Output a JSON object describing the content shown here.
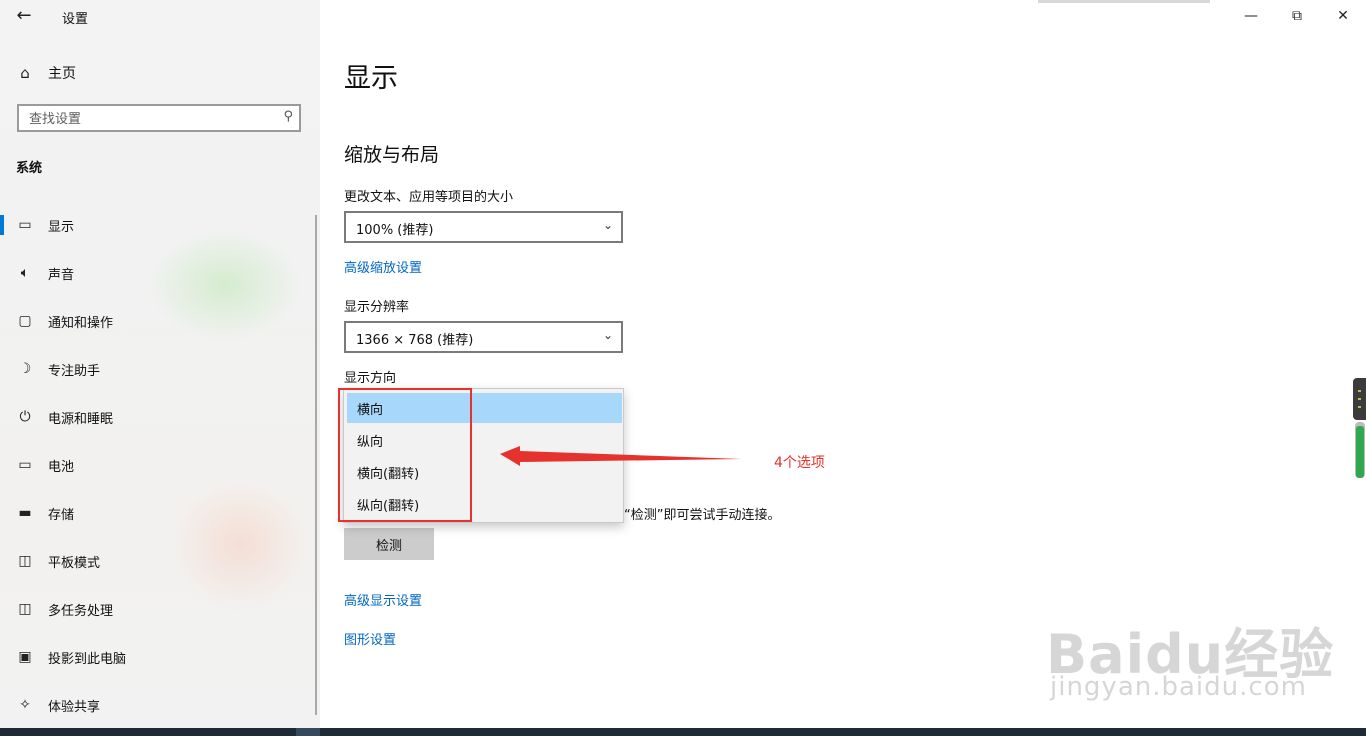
{
  "window": {
    "title": "设置",
    "minimize_icon": "minimize-icon",
    "maximize_icon": "restore-icon",
    "close_icon": "close-icon"
  },
  "sidebar": {
    "home_label": "主页",
    "search_placeholder": "查找设置",
    "section": "系统",
    "items": [
      {
        "label": "显示",
        "icon": "monitor-icon",
        "active": true
      },
      {
        "label": "声音",
        "icon": "speaker-icon"
      },
      {
        "label": "通知和操作",
        "icon": "notification-icon"
      },
      {
        "label": "专注助手",
        "icon": "moon-icon"
      },
      {
        "label": "电源和睡眠",
        "icon": "power-icon"
      },
      {
        "label": "电池",
        "icon": "battery-icon"
      },
      {
        "label": "存储",
        "icon": "storage-icon"
      },
      {
        "label": "平板模式",
        "icon": "tablet-icon"
      },
      {
        "label": "多任务处理",
        "icon": "multitask-icon"
      },
      {
        "label": "投影到此电脑",
        "icon": "project-icon"
      },
      {
        "label": "体验共享",
        "icon": "share-icon"
      }
    ]
  },
  "main": {
    "title": "显示",
    "section": "缩放与布局",
    "scale_label": "更改文本、应用等项目的大小",
    "scale_value": "100% (推荐)",
    "advanced_scaling_link": "高级缩放设置",
    "resolution_label": "显示分辨率",
    "resolution_value": "1366 × 768 (推荐)",
    "orientation_label": "显示方向",
    "orientation_options": [
      "横向",
      "纵向",
      "横向(翻转)",
      "纵向(翻转)"
    ],
    "orientation_selected": "横向",
    "detect_hint": "“检测”即可尝试手动连接。",
    "detect_button": "检测",
    "advanced_display_link": "高级显示设置",
    "graphics_link": "图形设置"
  },
  "annotation": {
    "text": "4个选项",
    "color": "#e5322c"
  },
  "watermark": {
    "brand": "Baidu经验",
    "url": "jingyan.baidu.com"
  },
  "colors": {
    "accent": "#0078d7",
    "link": "#0067c0",
    "selected": "#a7d7fa"
  }
}
